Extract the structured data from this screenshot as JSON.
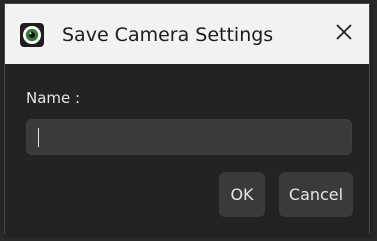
{
  "window": {
    "title": "Save Camera Settings",
    "icon": "camera-app-icon",
    "close_icon": "close-icon"
  },
  "form": {
    "name_label": "Name :",
    "name_value": "",
    "name_placeholder": ""
  },
  "buttons": {
    "ok_label": "OK",
    "cancel_label": "Cancel"
  },
  "colors": {
    "titlebar_bg": "#f2f2f2",
    "dialog_bg": "#232323",
    "input_bg": "#3a3a3a",
    "button_bg": "#3a3a3a",
    "text_light": "#e6e6e6",
    "icon_green": "#2e7d32"
  }
}
